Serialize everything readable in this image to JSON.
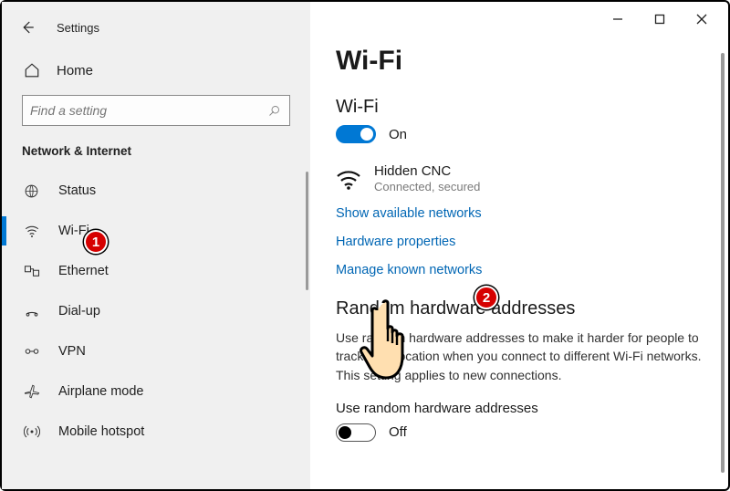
{
  "header": {
    "settings": "Settings",
    "home": "Home"
  },
  "search": {
    "placeholder": "Find a setting"
  },
  "section": "Network & Internet",
  "nav": {
    "status": "Status",
    "wifi": "Wi-Fi",
    "ethernet": "Ethernet",
    "dialup": "Dial-up",
    "vpn": "VPN",
    "airplane": "Airplane mode",
    "hotspot": "Mobile hotspot"
  },
  "main": {
    "title": "Wi-Fi",
    "wifi_label": "Wi-Fi",
    "wifi_state": "On",
    "conn_name": "Hidden CNC",
    "conn_status": "Connected, secured",
    "link_available": "Show available networks",
    "link_hwprops": "Hardware properties",
    "link_manage": "Manage known networks",
    "random_title": "Random hardware addresses",
    "random_desc": "Use random hardware addresses to make it harder for people to track your location when you connect to different Wi-Fi networks. This setting applies to new connections.",
    "random_sublabel": "Use random hardware addresses",
    "random_state": "Off"
  },
  "annotations": {
    "one": "1",
    "two": "2"
  }
}
